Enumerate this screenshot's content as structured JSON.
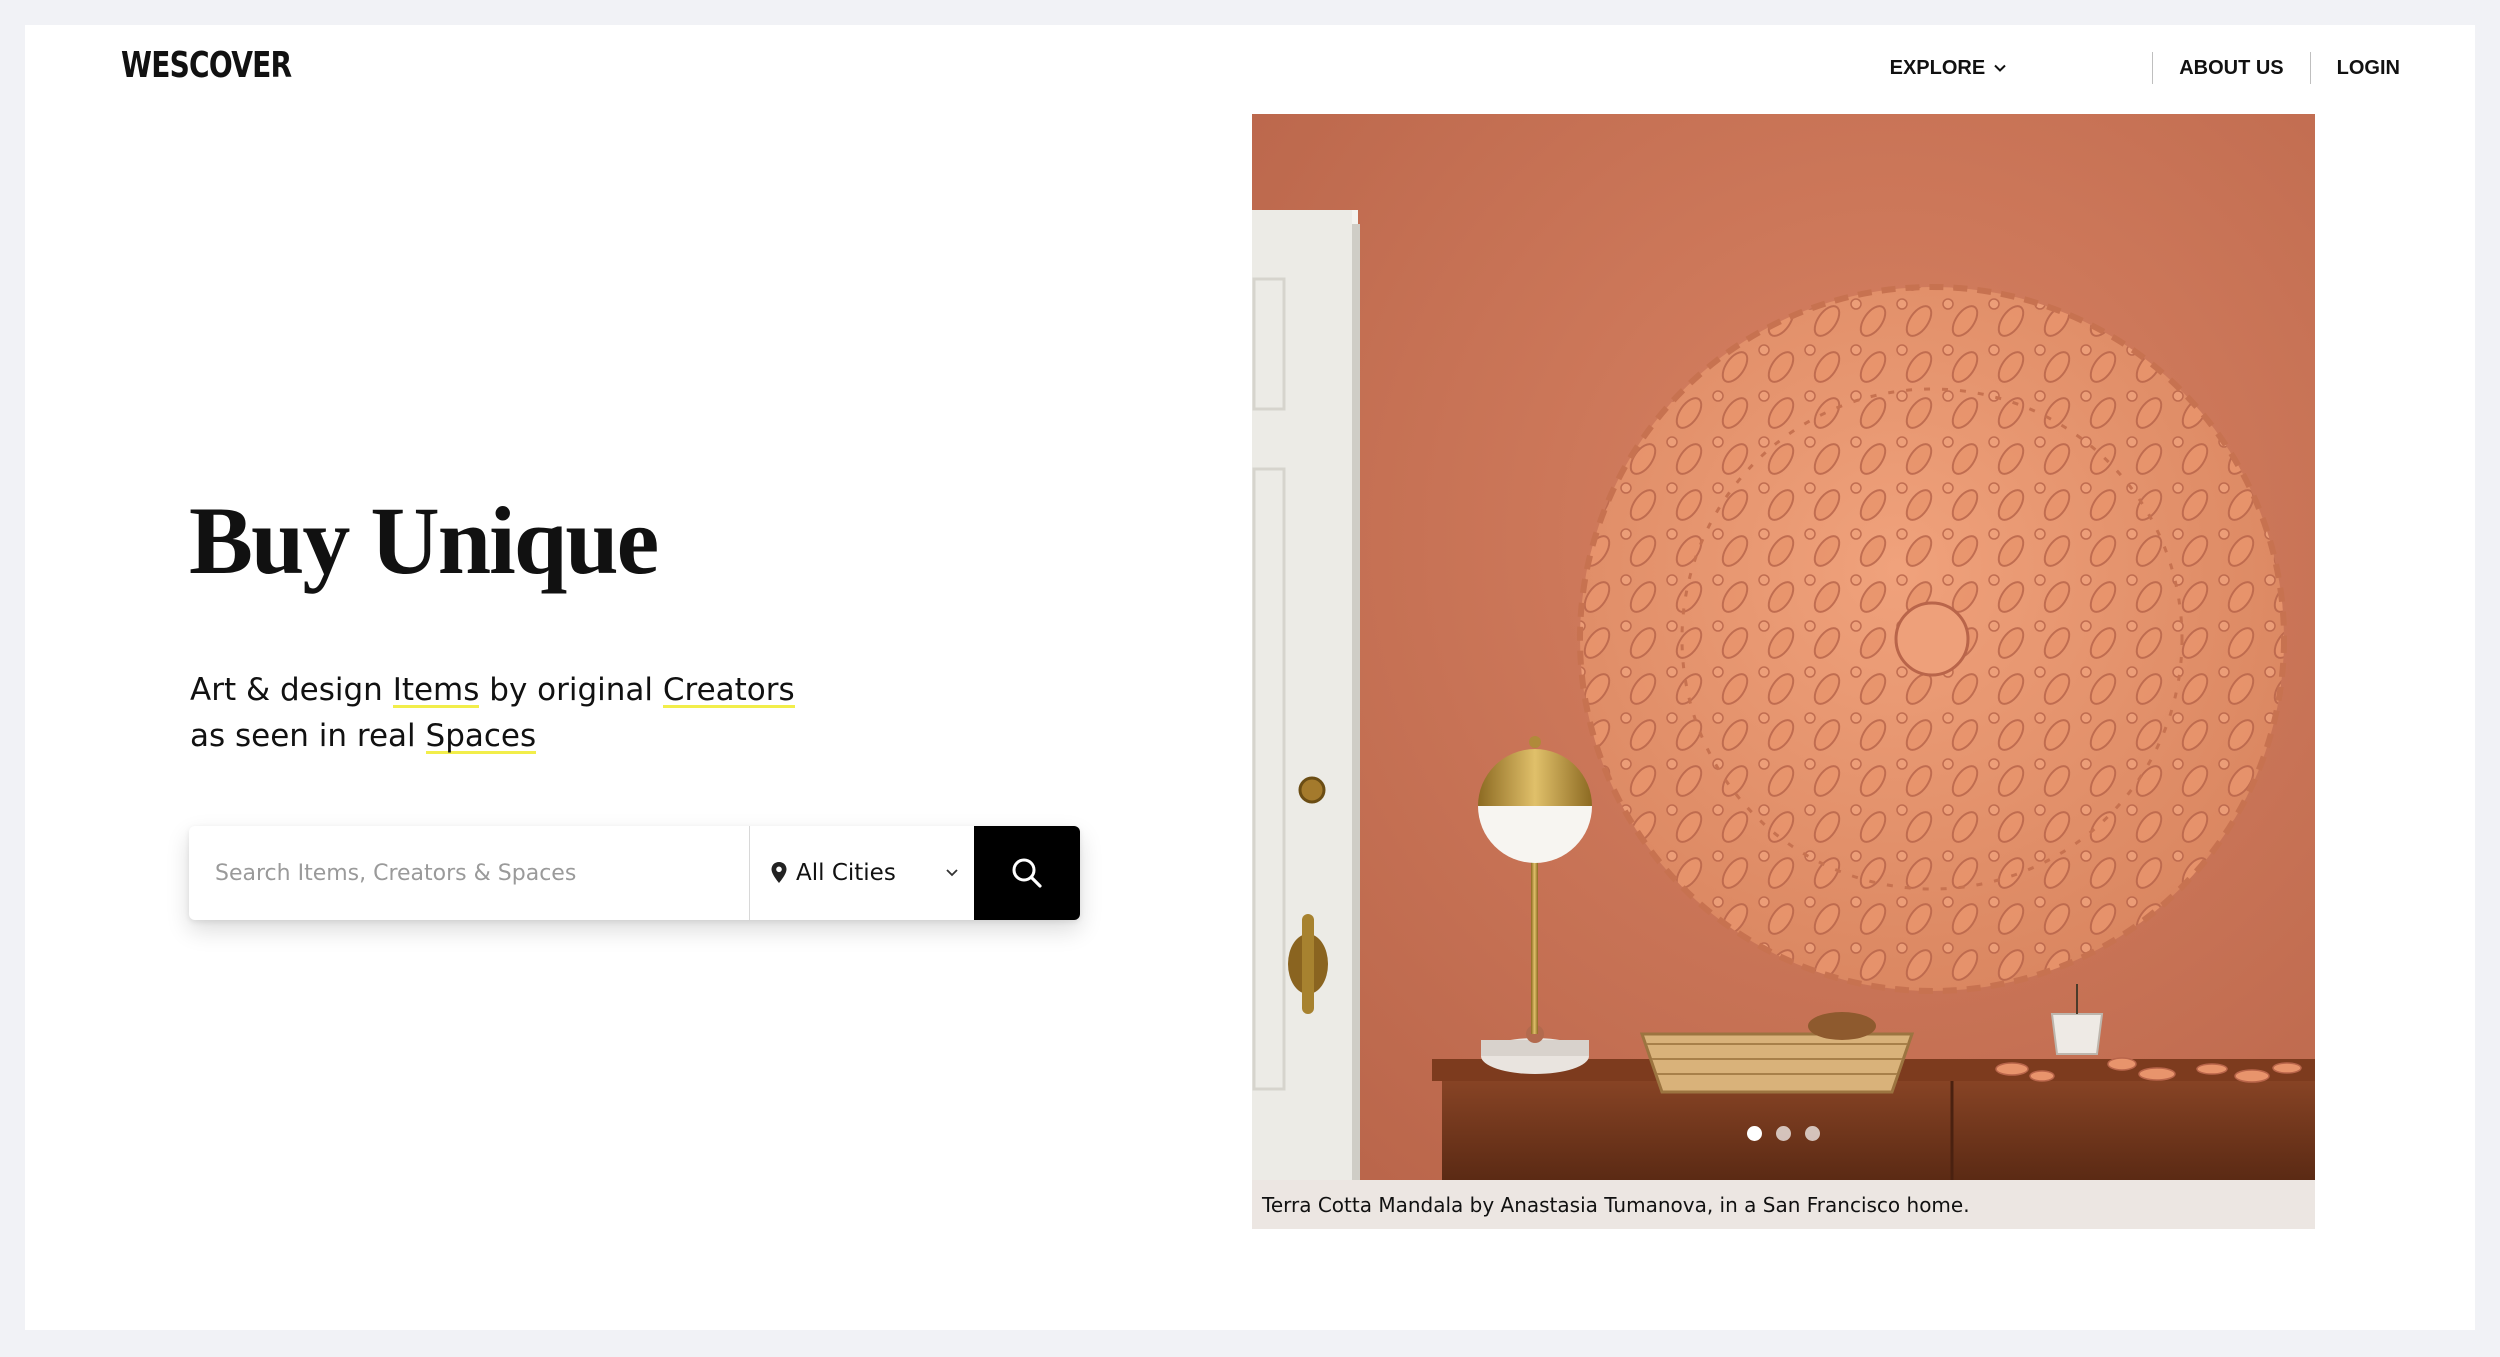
{
  "brand": {
    "logo": "WESCOVER"
  },
  "nav": {
    "explore": "EXPLORE",
    "about": "ABOUT US",
    "login": "LOGIN"
  },
  "hero": {
    "title": "Buy Unique",
    "tagline": {
      "part1": "Art & design ",
      "items": "Items",
      "part2": " by original ",
      "creators": "Creators",
      "part3": "as seen in real ",
      "spaces": "Spaces"
    }
  },
  "search": {
    "placeholder": "Search Items, Creators & Spaces",
    "value": "",
    "city": "All Cities"
  },
  "carousel": {
    "caption": "Terra Cotta Mandala by Anastasia Tumanova, in a San Francisco home.",
    "slide_count": 3,
    "active_index": 0
  },
  "colors": {
    "accent_underline": "#f2ee4a",
    "search_button": "#000000",
    "wall": "#c97456"
  }
}
